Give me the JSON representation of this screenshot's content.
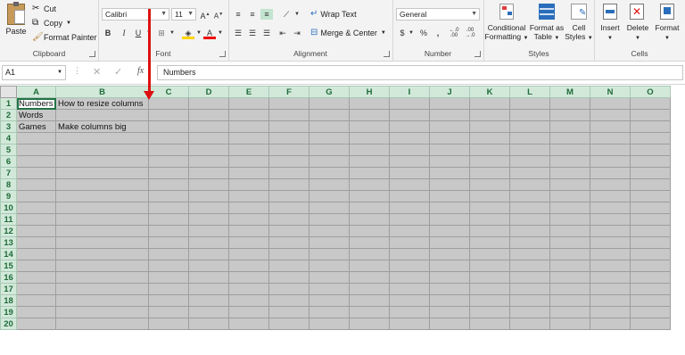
{
  "ribbon": {
    "clipboard": {
      "label": "Clipboard",
      "paste": "Paste",
      "cut": "Cut",
      "copy": "Copy",
      "format_painter": "Format Painter"
    },
    "font": {
      "label": "Font",
      "name": "Calibri",
      "size": "11"
    },
    "alignment": {
      "label": "Alignment",
      "wrap_text": "Wrap Text",
      "merge_center": "Merge & Center"
    },
    "number": {
      "label": "Number",
      "format": "General"
    },
    "styles": {
      "label": "Styles",
      "conditional_1": "Conditional",
      "conditional_2": "Formatting",
      "format_table_1": "Format as",
      "format_table_2": "Table",
      "cell_styles_1": "Cell",
      "cell_styles_2": "Styles"
    },
    "cells": {
      "label": "Cells",
      "insert": "Insert",
      "delete": "Delete",
      "format": "Format"
    }
  },
  "formula_bar": {
    "name_box": "A1",
    "fx": "fx",
    "content": "Numbers"
  },
  "sheet": {
    "columns": [
      "A",
      "B",
      "C",
      "D",
      "E",
      "F",
      "G",
      "H",
      "I",
      "J",
      "K",
      "L",
      "M",
      "N",
      "O"
    ],
    "rows": [
      "1",
      "2",
      "3",
      "4",
      "5",
      "6",
      "7",
      "8",
      "9",
      "10",
      "11",
      "12",
      "13",
      "14",
      "15",
      "16",
      "17",
      "18",
      "19",
      "20"
    ],
    "cells": {
      "A1": "Numbers",
      "B1": "How to resize columns",
      "A2": "Words",
      "A3": "Games",
      "B3": "Make columns big"
    }
  },
  "colors": {
    "accent": "#217346",
    "arrow": "#dd1111",
    "cell_fill": "#c8c8c8"
  }
}
